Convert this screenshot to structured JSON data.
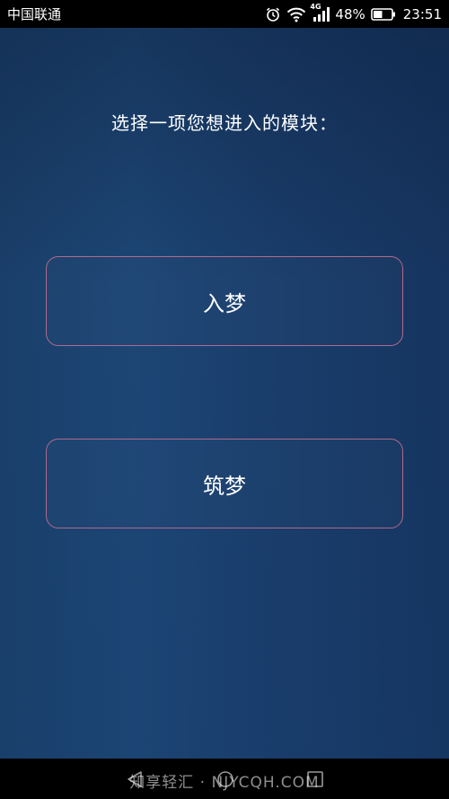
{
  "status_bar": {
    "carrier": "中国联通",
    "network_type": "4G",
    "battery_percent": "48%",
    "time": "23:51",
    "icons": [
      "alarm-icon",
      "wifi-icon",
      "signal-icon",
      "battery-icon"
    ]
  },
  "main": {
    "prompt": "选择一项您想进入的模块：",
    "modules": [
      {
        "label": "入梦"
      },
      {
        "label": "筑梦"
      }
    ]
  },
  "nav_bar": {
    "watermark": "知享轻汇 · NJYCQH.COM",
    "icons": [
      "back-icon",
      "home-icon",
      "recent-apps-icon"
    ]
  },
  "colors": {
    "background": "#1a3f6a",
    "button_border": "#b06a8c",
    "text": "#ffffff"
  }
}
